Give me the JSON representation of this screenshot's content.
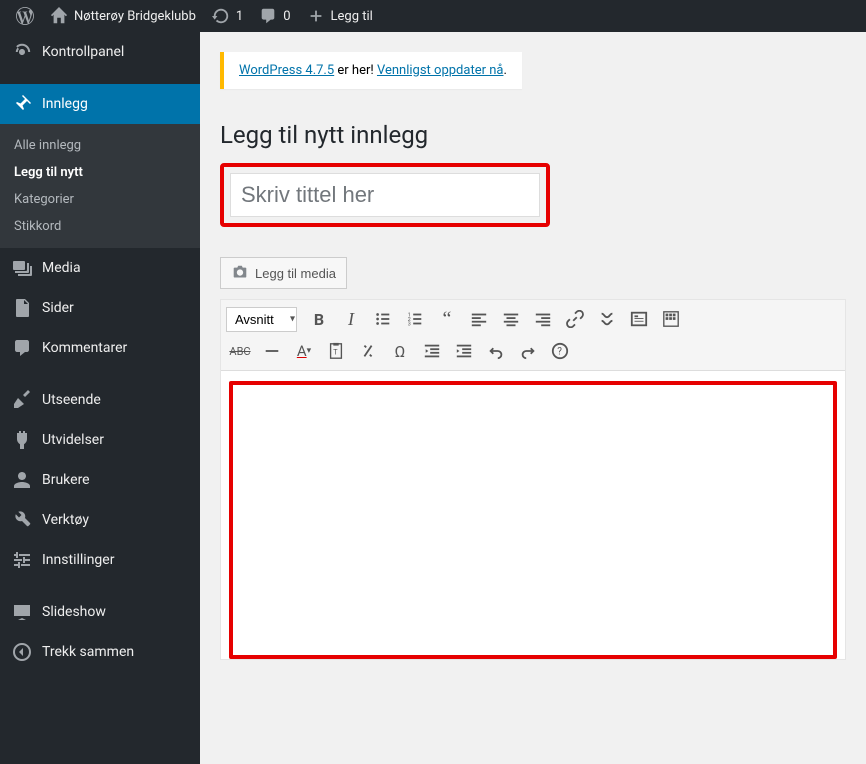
{
  "adminbar": {
    "site_name": "Nøtterøy Bridgeklubb",
    "updates_count": "1",
    "comments_count": "0",
    "new_label": "Legg til"
  },
  "sidebar": {
    "dashboard": "Kontrollpanel",
    "posts": "Innlegg",
    "posts_sub": {
      "all": "Alle innlegg",
      "add": "Legg til nytt",
      "categories": "Kategorier",
      "tags": "Stikkord"
    },
    "media": "Media",
    "pages": "Sider",
    "comments": "Kommentarer",
    "appearance": "Utseende",
    "plugins": "Utvidelser",
    "users": "Brukere",
    "tools": "Verktøy",
    "settings": "Innstillinger",
    "slideshow": "Slideshow",
    "collapse": "Trekk sammen"
  },
  "notice": {
    "link1": "WordPress 4.7.5",
    "text": " er her! ",
    "link2": "Vennligst oppdater nå",
    "period": "."
  },
  "page_title": "Legg til nytt innlegg",
  "title_placeholder": "Skriv tittel her",
  "media_button": "Legg til media",
  "format_dropdown": "Avsnitt"
}
